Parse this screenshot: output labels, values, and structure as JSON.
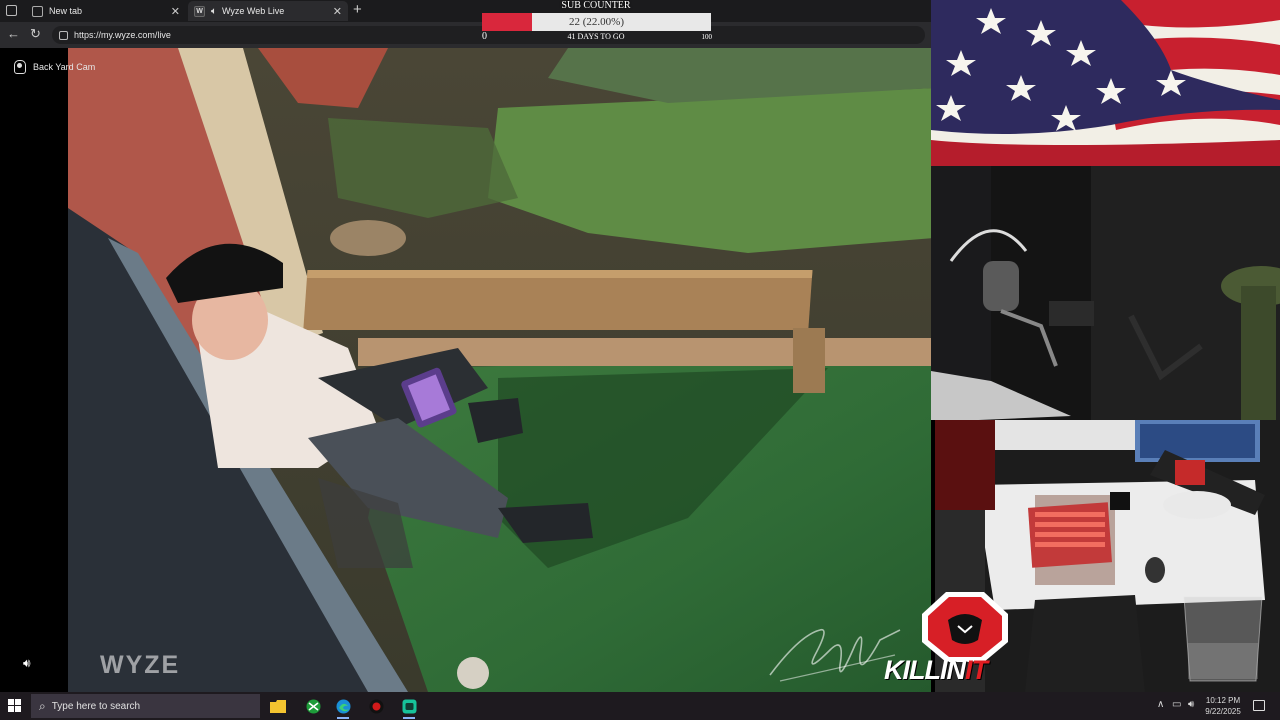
{
  "browser": {
    "tabs": [
      {
        "label": "New tab",
        "active": false
      },
      {
        "label": "Wyze Web Live",
        "active": true
      }
    ],
    "url": "https://my.wyze.com/live"
  },
  "camera": {
    "name": "Back Yard Cam",
    "brand": "WYZE"
  },
  "sub_counter": {
    "title": "SUB COUNTER",
    "value_text": "22 (22.00%)",
    "current": 22,
    "goal": 100,
    "progress_fraction": 0.22,
    "min_label": "0",
    "max_label": "100",
    "days_text": "41 DAYS TO GO",
    "fill_color": "#d9273c"
  },
  "branding": {
    "word_left": "KILLIN",
    "word_right": "IT"
  },
  "taskbar": {
    "search_placeholder": "Type here to search",
    "time": "10:12 PM",
    "date": "9/22/2025"
  }
}
